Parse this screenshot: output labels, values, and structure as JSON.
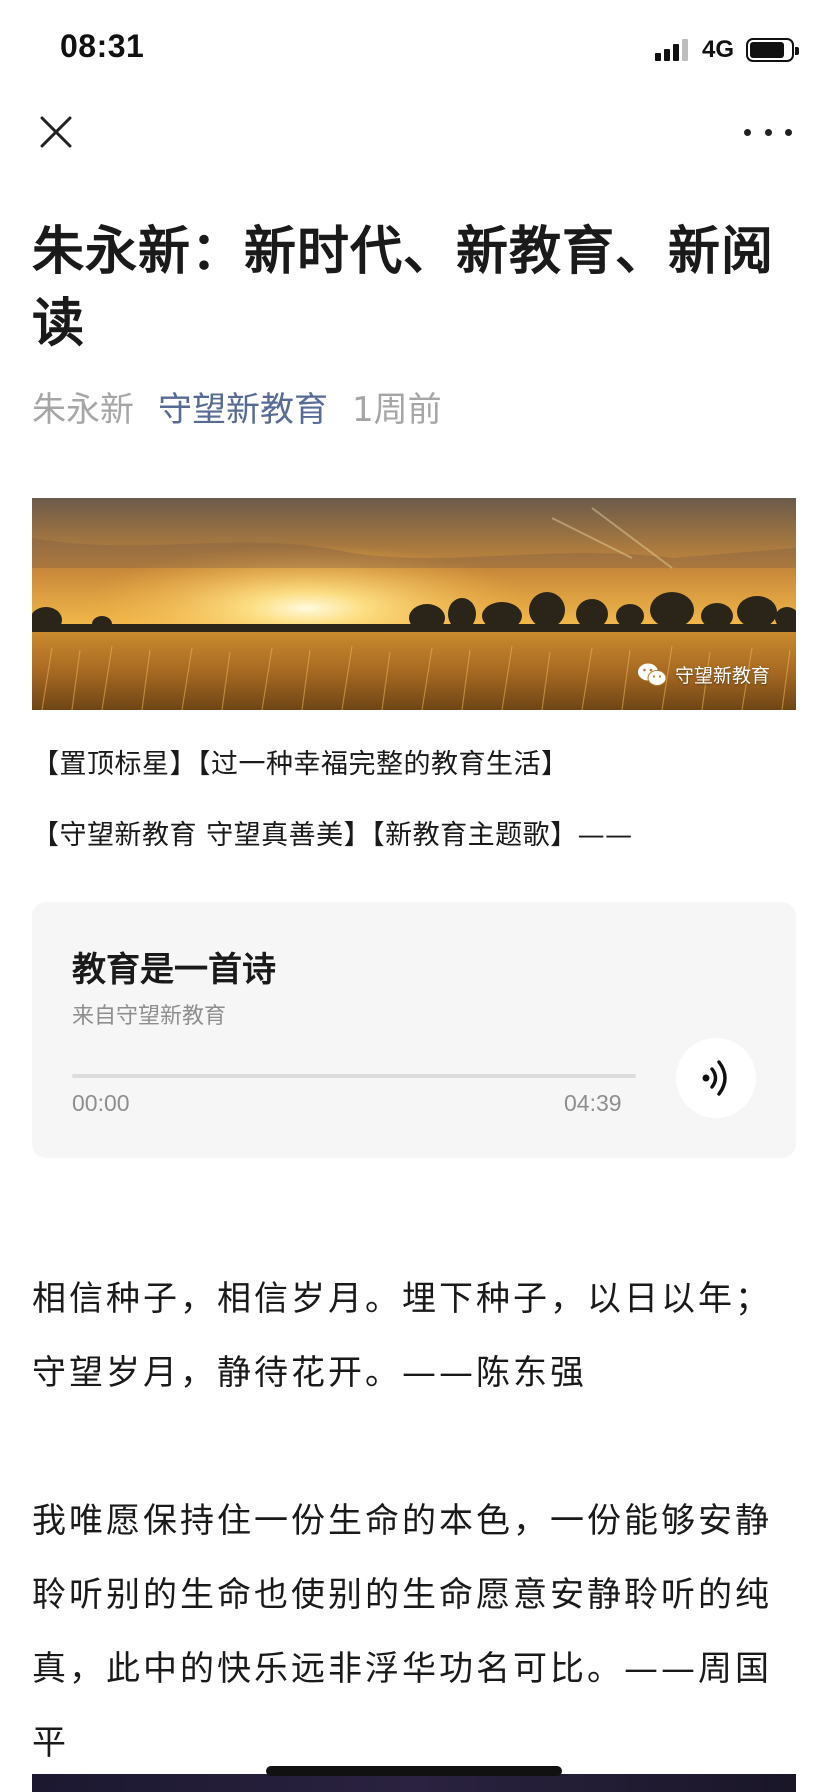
{
  "status_bar": {
    "time": "08:31",
    "network": "4G"
  },
  "nav": {
    "close_icon": "close-icon",
    "more_icon": "more-icon"
  },
  "article": {
    "title": "朱永新：新时代、新教育、新阅读",
    "author": "朱永新",
    "account": "守望新教育",
    "published": "1周前"
  },
  "banner": {
    "watermark": "守望新教育",
    "watermark_icon": "wechat-icon"
  },
  "tags": {
    "line1": "【置顶标星】【过一种幸福完整的教育生活】",
    "line2": "【守望新教育 守望真善美】【新教育主题歌】——"
  },
  "audio": {
    "title": "教育是一首诗",
    "source": "来自守望新教育",
    "current_time": "00:00",
    "duration": "04:39",
    "progress": 0,
    "play_icon": "play-audio-icon"
  },
  "paragraphs": {
    "p1": "相信种子，相信岁月。埋下种子，以日以年；守望岁月，静待花开。——陈东强",
    "p2": "我唯愿保持住一份生命的本色，一份能够安静聆听别的生命也使别的生命愿意安静聆听的纯真，此中的快乐远非浮华功名可比。——周国平"
  },
  "colors": {
    "link": "#576b95",
    "muted": "#a6a6a6",
    "text": "#1a1a1a",
    "card_bg": "#f6f6f6"
  }
}
